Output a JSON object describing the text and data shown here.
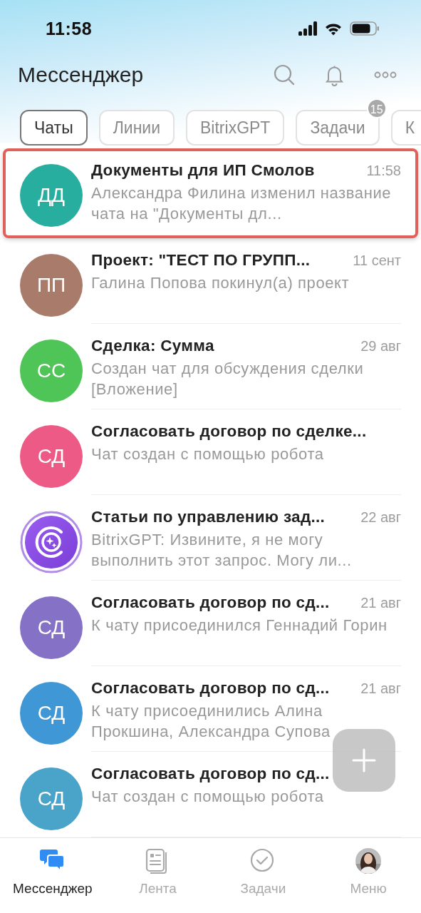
{
  "status_bar": {
    "time": "11:58"
  },
  "header": {
    "title": "Мессенджер"
  },
  "filters": [
    {
      "label": "Чаты",
      "selected": true
    },
    {
      "label": "Линии",
      "selected": false
    },
    {
      "label": "BitrixGPT",
      "selected": false
    },
    {
      "label": "Задачи",
      "selected": false,
      "badge": "15"
    },
    {
      "label": "К",
      "selected": false
    }
  ],
  "chats": [
    {
      "kind": "initials",
      "initials": "ДД",
      "color": "#27ae9e",
      "title": "Документы для ИП Смолов",
      "time": "11:58",
      "preview": "Александра Филина изменил название чата на \"Документы дл...",
      "highlighted": true
    },
    {
      "kind": "initials",
      "initials": "ПП",
      "color": "#a97b6a",
      "title": "Проект: \"ТЕСТ ПО ГРУПП...",
      "time": "11 сент",
      "preview": "Галина Попова покинул(а) проект",
      "highlighted": false
    },
    {
      "kind": "initials",
      "initials": "СС",
      "color": "#4fc558",
      "title": "Сделка: Сумма",
      "time": "29 авг",
      "preview": "Создан чат для обсуждения сделки [Вложение]",
      "highlighted": false
    },
    {
      "kind": "initials",
      "initials": "СД",
      "color": "#ee5a86",
      "title": "Согласовать договор по сделке...",
      "preview": "Чат создан с помощью робота",
      "highlighted": false
    },
    {
      "kind": "bot",
      "color": "#7a3fd8",
      "title": "Статьи по управлению зад...",
      "time": "22 авг",
      "preview": "BitrixGPT: Извините, я не могу выполнить этот запрос. Могу ли...",
      "highlighted": false
    },
    {
      "kind": "initials",
      "initials": "СД",
      "color": "#8572c6",
      "title": "Согласовать договор по сд...",
      "time": "21 авг",
      "preview": "К чату присоединился Геннадий Горин",
      "highlighted": false
    },
    {
      "kind": "initials",
      "initials": "СД",
      "color": "#3f98d5",
      "title": "Согласовать договор по сд...",
      "time": "21 авг",
      "preview": "К чату присоединились Алина Прокшина, Александра Супова",
      "highlighted": false
    },
    {
      "kind": "initials",
      "initials": "СД",
      "color": "#4aa4c9",
      "title": "Согласовать договор по сд...",
      "preview": "Чат создан с помощью робота",
      "highlighted": false
    }
  ],
  "nav": [
    {
      "kind": "chats",
      "label": "Мессенджер",
      "selected": true
    },
    {
      "kind": "feed",
      "label": "Лента",
      "selected": false
    },
    {
      "kind": "tasks",
      "label": "Задачи",
      "selected": false
    },
    {
      "kind": "avatar",
      "label": "Меню",
      "selected": false
    }
  ]
}
